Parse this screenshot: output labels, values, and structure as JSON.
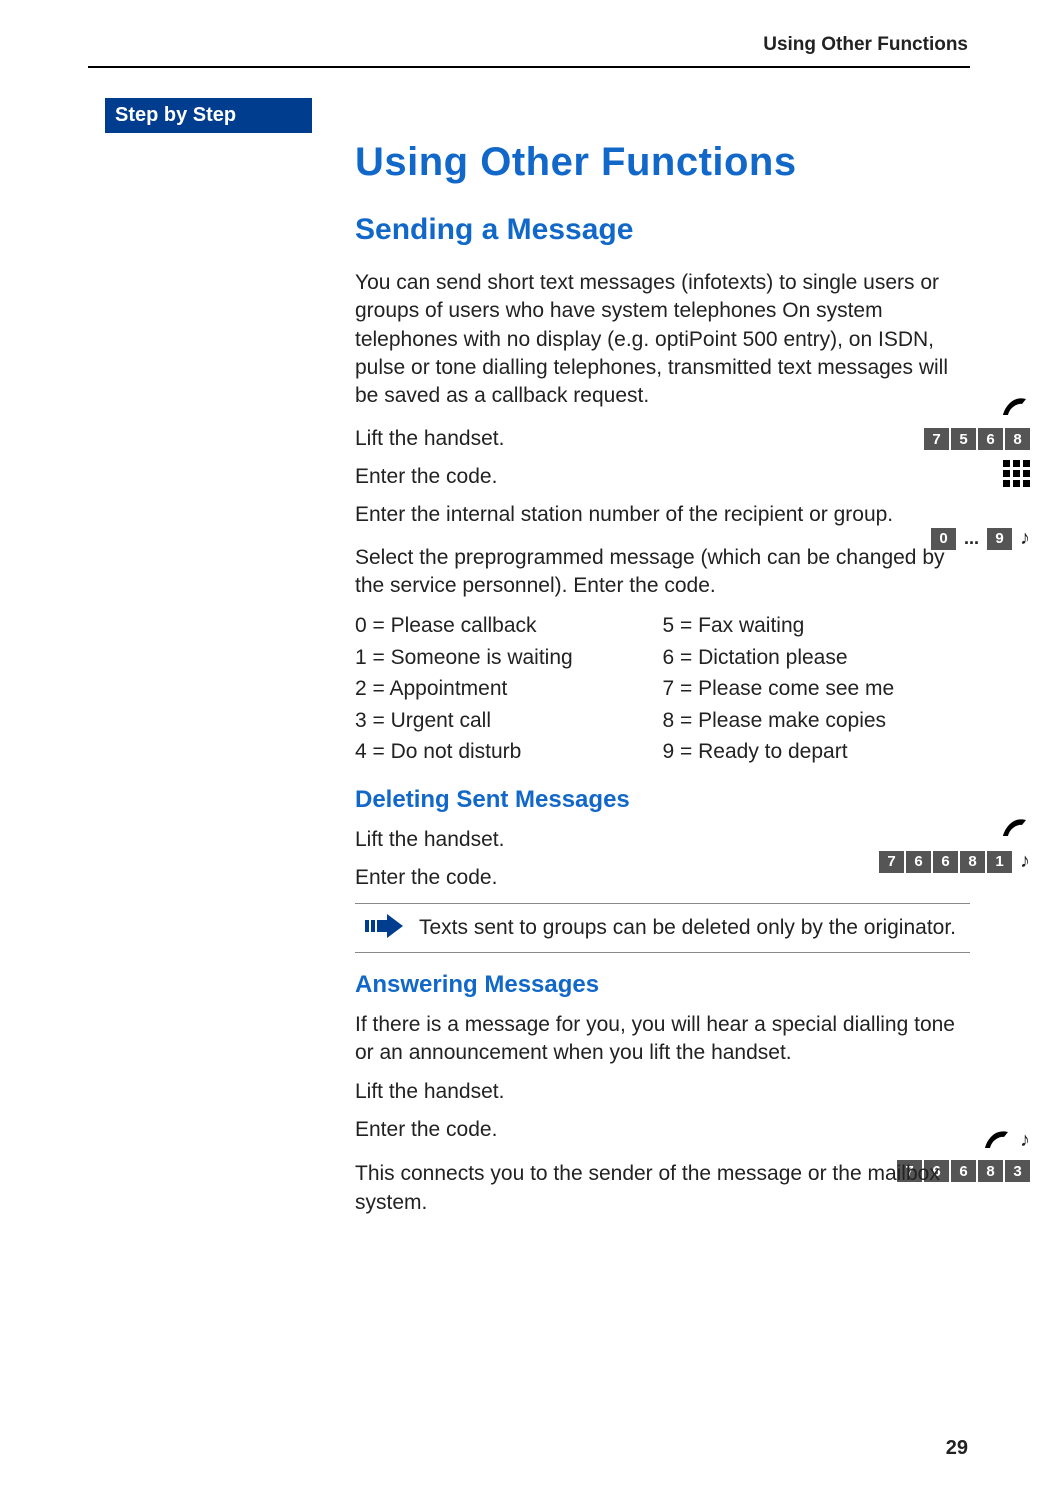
{
  "header": {
    "section_label": "Using Other Functions"
  },
  "sidebar": {
    "title": "Step by Step"
  },
  "main": {
    "h1": "Using Other Functions",
    "sending": {
      "h2": "Sending a Message",
      "intro": "You can send short text messages (infotexts) to single users or groups of users who have system telephones On system telephones with no display (e.g. optiPoint 500 entry), on ISDN, pulse or tone dialling telephones, transmitted text messages will be saved as a callback request.",
      "step_lift": "Lift the handset.",
      "step_code": "Enter the code.",
      "code_digits": [
        "7",
        "5",
        "6",
        "8"
      ],
      "step_station": "Enter the internal station number of the recipient or group.",
      "step_select": "Select the preprogrammed message (which can be changed by the service personnel). Enter the code.",
      "range_from": "0",
      "range_to": "9",
      "messages_left": [
        "0 = Please callback",
        "1 = Someone is waiting",
        "2 = Appointment",
        "3 = Urgent call",
        "4 = Do not disturb"
      ],
      "messages_right": [
        "5 = Fax waiting",
        "6 = Dictation please",
        "7 = Please come see me",
        "8 = Please make copies",
        "9 = Ready to depart"
      ]
    },
    "deleting": {
      "h3": "Deleting Sent Messages",
      "step_lift": "Lift the handset.",
      "step_code": "Enter the code.",
      "code_digits": [
        "7",
        "6",
        "6",
        "8",
        "1"
      ],
      "note": "Texts sent to groups can be deleted only by the originator."
    },
    "answering": {
      "h3": "Answering Messages",
      "intro": "If there is a message for you, you will hear a special dialling tone or an announcement when you lift the handset.",
      "step_lift": "Lift the handset.",
      "step_code": "Enter the code.",
      "code_digits": [
        "7",
        "6",
        "6",
        "8",
        "3"
      ],
      "outro": "This connects you to the sender of the message or the mailbox system."
    }
  },
  "page_number": "29"
}
